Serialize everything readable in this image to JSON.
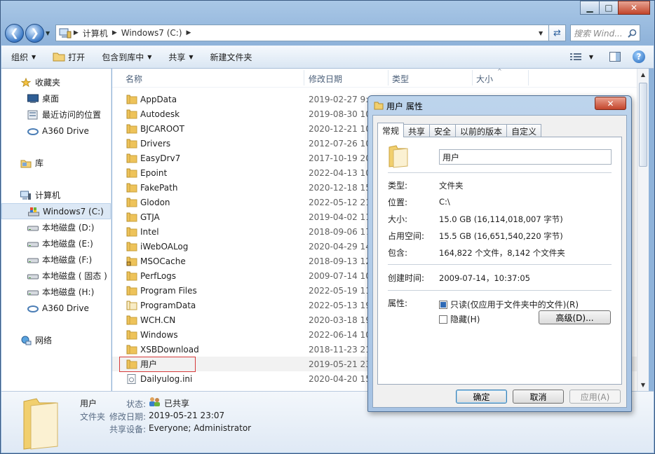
{
  "window": {
    "minimize": "▁",
    "maximize": "□",
    "close": "✕"
  },
  "address": {
    "segments": [
      "计算机",
      "Windows7 (C:)"
    ],
    "search_placeholder": "搜索 Wind..."
  },
  "toolbar": {
    "organize": "组织",
    "open": "打开",
    "include": "包含到库中",
    "share": "共享",
    "new_folder": "新建文件夹"
  },
  "nav": {
    "favorites": "收藏夹",
    "desktop": "桌面",
    "recent": "最近访问的位置",
    "a360_1": "A360 Drive",
    "library": "库",
    "computer": "计算机",
    "c_drive": "Windows7 (C:)",
    "d_drive": "本地磁盘 (D:)",
    "e_drive": "本地磁盘 (E:)",
    "f_drive": "本地磁盘 (F:)",
    "g_drive": "本地磁盘 ( 固态 )",
    "h_drive": "本地磁盘 (H:)",
    "a360_2": "A360 Drive",
    "network": "网络"
  },
  "columns": {
    "name": "名称",
    "modified": "修改日期",
    "type": "类型",
    "size": "大小"
  },
  "files": [
    {
      "name": "AppData",
      "date": "2019-02-27 9:5"
    },
    {
      "name": "Autodesk",
      "date": "2019-08-30 10"
    },
    {
      "name": "BJCAROOT",
      "date": "2020-12-21 10"
    },
    {
      "name": "Drivers",
      "date": "2012-07-26 10"
    },
    {
      "name": "EasyDrv7",
      "date": "2017-10-19 20"
    },
    {
      "name": "Epoint",
      "date": "2022-04-13 10"
    },
    {
      "name": "FakePath",
      "date": "2020-12-18 15"
    },
    {
      "name": "Glodon",
      "date": "2022-05-12 21"
    },
    {
      "name": "GTJA",
      "date": "2019-04-02 11"
    },
    {
      "name": "Intel",
      "date": "2018-09-06 17"
    },
    {
      "name": "iWebOALog",
      "date": "2020-04-29 14"
    },
    {
      "name": "MSOCache",
      "date": "2018-09-13 12"
    },
    {
      "name": "PerfLogs",
      "date": "2009-07-14 10"
    },
    {
      "name": "Program Files",
      "date": "2022-05-19 11"
    },
    {
      "name": "ProgramData",
      "date": "2022-05-13 19"
    },
    {
      "name": "WCH.CN",
      "date": "2020-03-18 19"
    },
    {
      "name": "Windows",
      "date": "2022-06-14 10"
    },
    {
      "name": "XSBDownload",
      "date": "2018-11-23 21"
    },
    {
      "name": "用户",
      "date": "2019-05-21 23"
    },
    {
      "name": "Dailyulog.ini",
      "date": "2020-04-20 15"
    }
  ],
  "details": {
    "name": "用户",
    "type": "文件夹",
    "state_label": "状态:",
    "state_value": "已共享",
    "modified_label": "修改日期:",
    "modified_value": "2019-05-21 23:07",
    "shared_label": "共享设备:",
    "shared_value": "Everyone; Administrator"
  },
  "dialog": {
    "title": "用户 属性",
    "close": "✕",
    "tabs": [
      "常规",
      "共享",
      "安全",
      "以前的版本",
      "自定义"
    ],
    "name_value": "用户",
    "type_label": "类型:",
    "type_value": "文件夹",
    "location_label": "位置:",
    "location_value": "C:\\",
    "size_label": "大小:",
    "size_value": "15.0 GB (16,114,018,007 字节)",
    "disk_label": "占用空间:",
    "disk_value": "15.5 GB (16,651,540,220 字节)",
    "contains_label": "包含:",
    "contains_value": "164,822 个文件，8,142 个文件夹",
    "created_label": "创建时间:",
    "created_value": "2009-07-14，10:37:05",
    "attrs_label": "属性:",
    "readonly_label": "只读(仅应用于文件夹中的文件)(R)",
    "hidden_label": "隐藏(H)",
    "advanced_button": "高级(D)...",
    "ok_button": "确定",
    "cancel_button": "取消",
    "apply_button": "应用(A)"
  }
}
